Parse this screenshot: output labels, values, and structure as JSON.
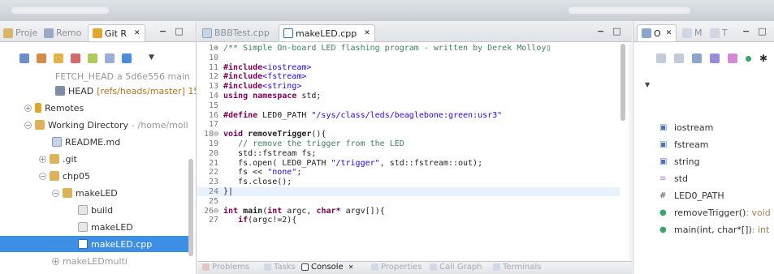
{
  "left_panel": {
    "tabs": [
      {
        "label": "Proje"
      },
      {
        "label": "Remo"
      },
      {
        "label": "Git R",
        "close": "✕"
      }
    ],
    "tree": [
      {
        "label": "FETCH_HEAD",
        "sub": "a 5d6e556 main"
      },
      {
        "label": "HEAD",
        "sub": "[refs/heads/master] 15"
      },
      {
        "label": "Remotes"
      },
      {
        "label": "Working Directory",
        "sub": " - /home/moll"
      },
      {
        "label": "README.md"
      },
      {
        "label": ".git"
      },
      {
        "label": "chp05"
      },
      {
        "label": "makeLED"
      },
      {
        "label": "build"
      },
      {
        "label": "makeLED"
      },
      {
        "label": "makeLED.cpp"
      },
      {
        "label": "makeLEDmulti"
      }
    ]
  },
  "editor": {
    "tabs": [
      {
        "label": "BBBTest.cpp"
      },
      {
        "label": "makeLED.cpp",
        "close": "✕"
      }
    ],
    "lines": [
      {
        "n": "1⊕",
        "html": "<span class='com'>/** Simple On-board LED flashing program - written by Derek Molloy▯</span>"
      },
      {
        "n": "10",
        "html": ""
      },
      {
        "n": "11",
        "html": "<span class='kw'>#include</span><span class='str'>&lt;iostream&gt;</span>"
      },
      {
        "n": "12",
        "html": "<span class='kw'>#include</span><span class='str'>&lt;fstream&gt;</span>"
      },
      {
        "n": "13",
        "html": "<span class='kw'>#include</span><span class='str'>&lt;string&gt;</span>"
      },
      {
        "n": "14",
        "html": "<span class='kw'>using namespace</span> std;"
      },
      {
        "n": "15",
        "html": ""
      },
      {
        "n": "16",
        "html": "<span class='kw'>#define</span> LED0_PATH <span class='str'>\"/sys/class/leds/beaglebone:green:usr3\"</span>"
      },
      {
        "n": "17",
        "html": ""
      },
      {
        "n": "18⊖",
        "html": "<span class='kw'>void</span> <b>removeTrigger</b>(){"
      },
      {
        "n": "19",
        "html": "   <span class='com'>// remove the trigger from the LED</span>"
      },
      {
        "n": "20",
        "html": "   std::fstream fs;"
      },
      {
        "n": "21",
        "html": "   fs.open( LED0_PATH <span class='str'>\"/trigger\"</span>, std::fstream::out);"
      },
      {
        "n": "22",
        "html": "   fs &lt;&lt; <span class='str'>\"none\"</span>;"
      },
      {
        "n": "23",
        "html": "   fs.close();"
      },
      {
        "n": "24",
        "html": "}|",
        "hl": true
      },
      {
        "n": "25",
        "html": ""
      },
      {
        "n": "26⊖",
        "html": "<span class='kw'>int</span> <b>main</b>(<span class='kw'>int</span> argc, <span class='kw'>char*</span> argv[]){"
      },
      {
        "n": "27",
        "html": "   <span class='kw'>if</span>(argc!=2){"
      }
    ]
  },
  "bottom_tabs": [
    {
      "label": "Problems"
    },
    {
      "label": "Tasks"
    },
    {
      "label": "Console",
      "close": "✕",
      "active": true
    },
    {
      "label": "Properties"
    },
    {
      "label": "Call Graph"
    },
    {
      "label": "Terminals"
    }
  ],
  "outline": {
    "tabs": [
      {
        "label": "O",
        "close": "✕"
      },
      {
        "label": "M"
      },
      {
        "label": "T"
      }
    ],
    "items": [
      {
        "label": "iostream",
        "sig": "",
        "color": "#4a6fb5",
        "glyph": "▣"
      },
      {
        "label": "fstream",
        "sig": "",
        "color": "#4a6fb5",
        "glyph": "▣"
      },
      {
        "label": "string",
        "sig": "",
        "color": "#4a6fb5",
        "glyph": "▣"
      },
      {
        "label": "std",
        "sig": "",
        "color": "#b57fd1",
        "glyph": "≡"
      },
      {
        "label": "LED0_PATH",
        "sig": "",
        "color": "#555",
        "glyph": "#"
      },
      {
        "label": "removeTrigger()",
        "sig": " : void",
        "color": "#3aa56b",
        "glyph": "●"
      },
      {
        "label": "main(int, char*[])",
        "sig": " : int",
        "color": "#3aa56b",
        "glyph": "●"
      }
    ]
  },
  "window_buttons": {
    "minimize": "−",
    "maximize": "□"
  }
}
